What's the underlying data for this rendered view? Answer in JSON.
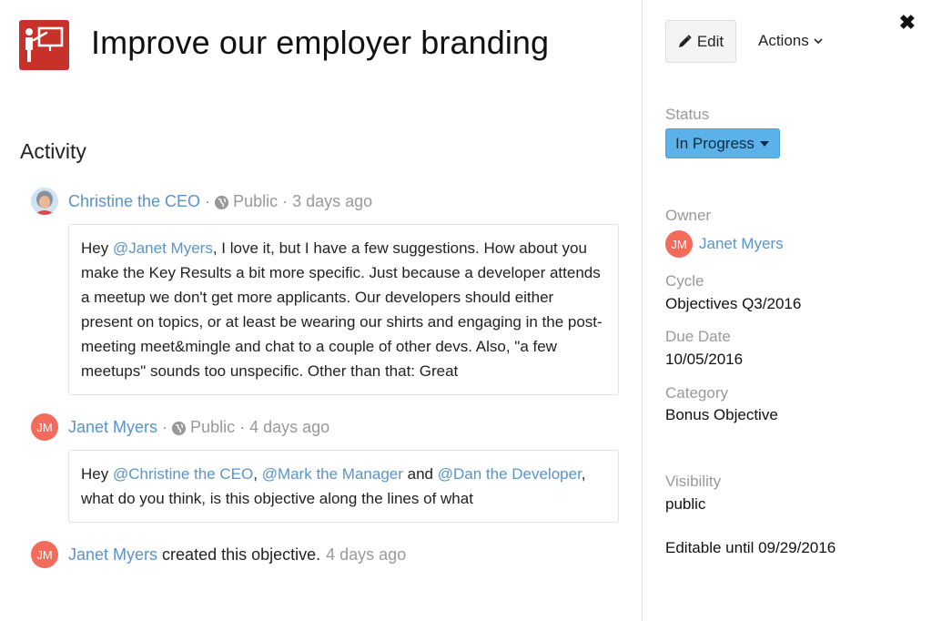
{
  "objective": {
    "title": "Improve our employer branding",
    "icon": "presentation-board-icon",
    "icon_color": "#c8302a"
  },
  "activity": {
    "heading": "Activity",
    "entries": [
      {
        "author": "Christine the CEO",
        "visibility": "Public",
        "time": "3 days ago",
        "avatar": "christine-photo",
        "comment": {
          "lead": "Hey ",
          "mention_1": "@Janet Myers",
          "text": ", I love it, but I have a few suggestions. How about you make the Key Results a bit more specific. Just because a developer attends a meetup we don't get more applicants. Our developers should either present on topics, or at least be wearing our shirts and engaging in the post-meeting meet&mingle and chat to a couple of other devs. Also, \"a few meetups\" sounds too unspecific. Other than that: Great"
        }
      },
      {
        "author": "Janet Myers",
        "initials": "JM",
        "visibility": "Public",
        "time": "4 days ago",
        "comment": {
          "lead": "Hey ",
          "mention_1": "@Christine the CEO",
          "sep_1": ", ",
          "mention_2": "@Mark the Manager",
          "sep_2": " and ",
          "mention_3": "@Dan the Developer",
          "text": ", what do you think, is this objective along the lines of what"
        }
      },
      {
        "author": "Janet Myers",
        "initials": "JM",
        "action": "created this objective.",
        "time": "4 days ago"
      }
    ]
  },
  "sidebar": {
    "edit_label": "Edit",
    "actions_label": "Actions",
    "close_icon": "close-icon",
    "status_label": "Status",
    "status_value": "In Progress",
    "status_color": "#5ab2e8",
    "owner_label": "Owner",
    "owner_name": "Janet Myers",
    "owner_initials": "JM",
    "cycle_label": "Cycle",
    "cycle_value": "Objectives Q3/2016",
    "due_label": "Due Date",
    "due_value": "10/05/2016",
    "category_label": "Category",
    "category_value": "Bonus Objective",
    "visibility_label": "Visibility",
    "visibility_value": "public",
    "editable_until": "Editable until 09/29/2016"
  },
  "colors": {
    "link": "#5a93c9",
    "avatar_jm": "#f26b5b",
    "muted": "#999999"
  }
}
